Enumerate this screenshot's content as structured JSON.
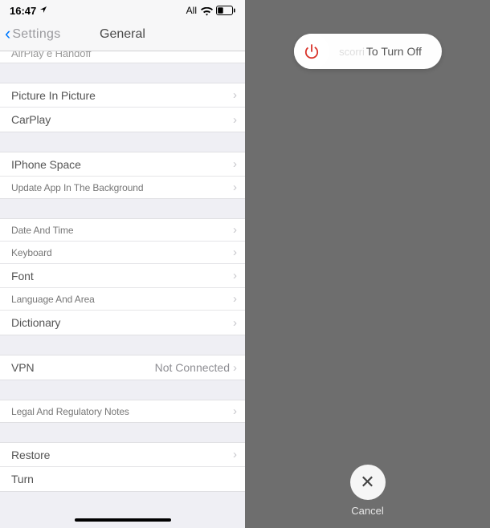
{
  "status": {
    "time": "16:47",
    "signal": "All",
    "battery_level": 35
  },
  "nav": {
    "back_label": "Settings",
    "title": "General"
  },
  "sections": {
    "s0": {
      "cutoff": "AirPlay e Handoff"
    },
    "s1": {
      "pip": "Picture In Picture",
      "carplay": "CarPlay"
    },
    "s2": {
      "storage": "IPhone Space",
      "bg_refresh": "Update App In The Background"
    },
    "s3": {
      "datetime": "Date And Time",
      "keyboard": "Keyboard",
      "font": "Font",
      "language": "Language And Area",
      "dictionary": "Dictionary"
    },
    "s4": {
      "vpn": "VPN",
      "vpn_value": "Not Connected"
    },
    "s5": {
      "legal": "Legal And Regulatory Notes"
    },
    "s6": {
      "restore": "Restore",
      "turn": "Turn"
    }
  },
  "power": {
    "slider_ghost": "scorri",
    "slider_text": "To Turn Off",
    "cancel": "Cancel"
  }
}
